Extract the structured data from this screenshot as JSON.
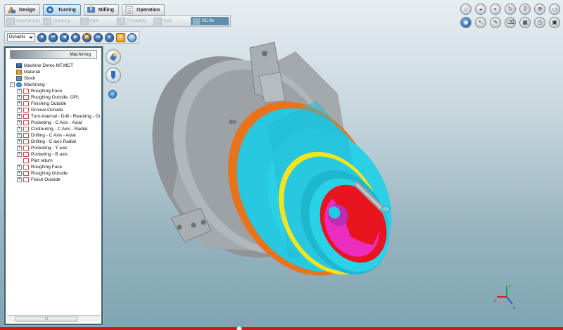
{
  "ribbon": {
    "tabs": [
      {
        "label": "Design",
        "active": false
      },
      {
        "label": "Turning",
        "active": true
      },
      {
        "label": "Milling",
        "active": false
      },
      {
        "label": "Operation",
        "active": false
      }
    ],
    "subtools": [
      {
        "label": "General Ops",
        "active": false
      },
      {
        "label": "Grooving",
        "active": false
      },
      {
        "label": "Hole",
        "active": false
      },
      {
        "label": "Threading",
        "active": false
      },
      {
        "label": "Part",
        "active": false
      },
      {
        "label": "NC file",
        "active": true
      }
    ]
  },
  "playback": {
    "mode_value": "Dynamic",
    "buttons": [
      "stop",
      "first",
      "rewind",
      "play",
      "forward",
      "last",
      "settings",
      "help",
      "go"
    ]
  },
  "right_toolbar": {
    "icons": [
      "top-view-icon",
      "front-view-icon",
      "side-view-icon",
      "rotate-icon",
      "zoom-icon",
      "zoom-window-icon",
      "display-icon",
      "view-cube-icon",
      "pointer-icon",
      "sketch-icon",
      "erase-icon",
      "grid-icon",
      "print-icon",
      "screen-icon"
    ]
  },
  "tree": {
    "header": "Machining",
    "items": [
      {
        "label": "Machine Demo MT.MCT",
        "level": 1,
        "expander": "",
        "icon": "machine"
      },
      {
        "label": "Material",
        "level": 1,
        "expander": "",
        "icon": "material"
      },
      {
        "label": "Stock",
        "level": 1,
        "expander": "",
        "icon": "stock"
      },
      {
        "label": "Machining",
        "level": 1,
        "expander": "−",
        "icon": "machining"
      },
      {
        "label": "Roughing Face",
        "level": 2,
        "expander": "+",
        "icon": "op"
      },
      {
        "label": "Roughing Outside, OPL",
        "level": 2,
        "expander": "+",
        "icon": "op"
      },
      {
        "label": "Finishing Outside",
        "level": 2,
        "expander": "+",
        "icon": "op"
      },
      {
        "label": "Groove Outside",
        "level": 2,
        "expander": "+",
        "icon": "op"
      },
      {
        "label": "Turn-Internal - Drill - Reaming - Gr",
        "level": 2,
        "expander": "+",
        "icon": "op"
      },
      {
        "label": "Pocketing - C Axis - Axial",
        "level": 2,
        "expander": "+",
        "icon": "op"
      },
      {
        "label": "Contouring - C Axis - Radial",
        "level": 2,
        "expander": "+",
        "icon": "op"
      },
      {
        "label": "Drilling - C Axis - Axial",
        "level": 2,
        "expander": "+",
        "icon": "op"
      },
      {
        "label": "Drilling - C axis Radial",
        "level": 2,
        "expander": "+",
        "icon": "op"
      },
      {
        "label": "Pocketing - Y axis",
        "level": 2,
        "expander": "+",
        "icon": "op"
      },
      {
        "label": "Pocketing - B axis",
        "level": 2,
        "expander": "+",
        "icon": "op"
      },
      {
        "label": "Part return",
        "level": 2,
        "expander": "",
        "icon": "op"
      },
      {
        "label": "Roughing Face",
        "level": 2,
        "expander": "+",
        "icon": "op"
      },
      {
        "label": "Roughing Outside",
        "level": 2,
        "expander": "+",
        "icon": "op"
      },
      {
        "label": "Finish Outside",
        "level": 2,
        "expander": "+",
        "icon": "op"
      }
    ]
  },
  "colors": {
    "chuck": "#9a9fa3",
    "ring_orange": "#e9731c",
    "part_cyan": "#27c8e0",
    "ring_yellow": "#f2e41f",
    "face_red": "#e8141e",
    "face_magenta": "#ec2ec0",
    "video_progress": "#cc1b14"
  },
  "triad": {
    "x": "x",
    "y": "y",
    "z": "z"
  }
}
